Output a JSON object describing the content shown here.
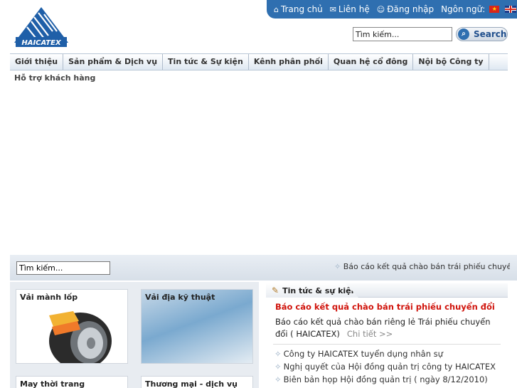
{
  "topbar": {
    "home": "Trang chủ",
    "contact": "Liên hệ",
    "login": "Đăng nhập",
    "language": "Ngôn ngữ:"
  },
  "logo": {
    "text": "HAICATEX"
  },
  "search": {
    "placeholder": "Tìm kiếm...",
    "button": "Search"
  },
  "nav": {
    "items": [
      "Giới thiệu",
      "Sản phẩm & Dịch vụ",
      "Tin tức & Sự kiện",
      "Kênh phân phối",
      "Quan hệ cổ đông",
      "Nội bộ Công ty"
    ],
    "sub": "Hỗ trợ khách hàng"
  },
  "ticker": {
    "placeholder": "Tìm kiếm...",
    "text": "Báo cáo kết quả chào bán trái phiếu chuyển đổi"
  },
  "products": [
    {
      "label": "Vải mành lốp"
    },
    {
      "label": "Vải địa kỹ thuật"
    },
    {
      "label": "May thời trang"
    },
    {
      "label": "Thương mại - dịch vụ"
    }
  ],
  "news": {
    "tab": "Tin tức & sự kiện",
    "headline": "Báo cáo kết quả chào bán trái phiếu chuyển đổi",
    "desc": "Báo cáo kết quả chào bán riêng lẻ Trái phiếu chuyển đổi ( HAICATEX)",
    "more": "Chi tiết >>",
    "items": [
      "Công ty HAICATEX tuyển dụng nhân sự",
      "Nghị quyết của Hội đồng quản trị công ty HAICATEX",
      "Biên bản họp Hội đồng quản trị ( ngày 8/12/2010)"
    ]
  }
}
